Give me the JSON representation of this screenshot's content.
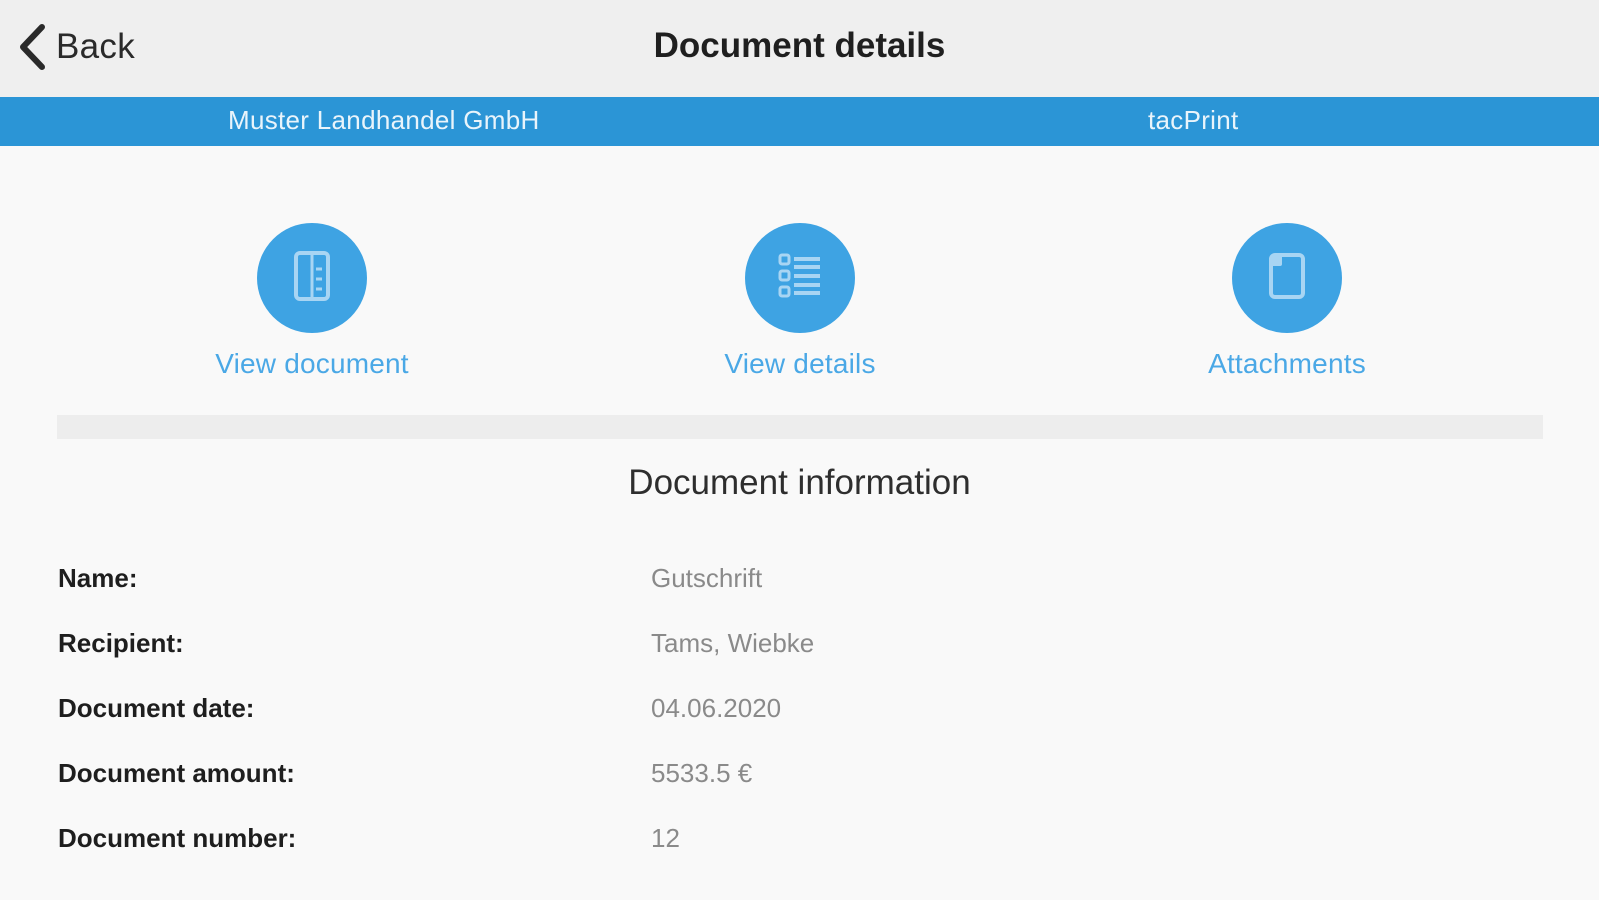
{
  "nav": {
    "back_label": "Back",
    "title": "Document details"
  },
  "company_bar": {
    "company": "Muster Landhandel GmbH",
    "app": "tacPrint"
  },
  "actions": [
    {
      "label": "View document",
      "icon": "document-icon"
    },
    {
      "label": "View details",
      "icon": "list-icon"
    },
    {
      "label": "Attachments",
      "icon": "attachment-icon"
    }
  ],
  "section": {
    "title": "Document information"
  },
  "info": [
    {
      "label": "Name:",
      "value": "Gutschrift"
    },
    {
      "label": "Recipient:",
      "value": "Tams, Wiebke"
    },
    {
      "label": "Document date:",
      "value": "04.06.2020"
    },
    {
      "label": "Document amount:",
      "value": "5533.5 €"
    },
    {
      "label": "Document number:",
      "value": "12"
    }
  ],
  "colors": {
    "accent": "#2b95d6",
    "icon_circle": "#3ea3e3",
    "link": "#4aa8e6"
  }
}
